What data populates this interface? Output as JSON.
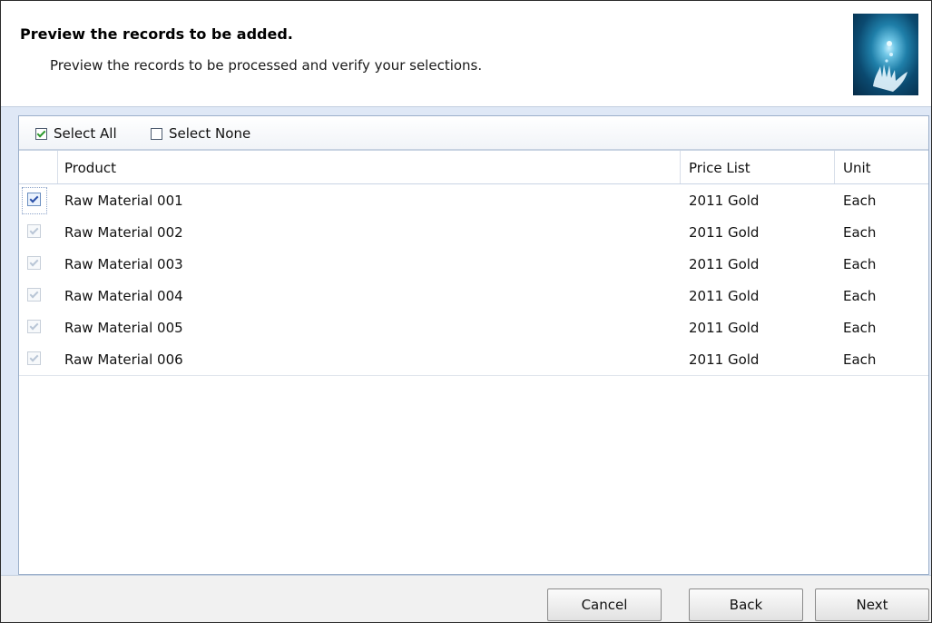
{
  "header": {
    "title": "Preview the records to be added.",
    "subtitle": "Preview the records to be processed and verify your selections.",
    "image_icon": "hand-light-icon"
  },
  "toolbar": {
    "select_all_label": "Select All",
    "select_all_checked": true,
    "select_none_label": "Select None",
    "select_none_checked": false
  },
  "grid": {
    "columns": [
      "Product",
      "Price List",
      "Unit"
    ],
    "rows": [
      {
        "checked": true,
        "product": "Raw Material 001",
        "price_list": "2011 Gold",
        "unit": "Each"
      },
      {
        "checked": true,
        "product": "Raw Material 002",
        "price_list": "2011 Gold",
        "unit": "Each"
      },
      {
        "checked": true,
        "product": "Raw Material 003",
        "price_list": "2011 Gold",
        "unit": "Each"
      },
      {
        "checked": true,
        "product": "Raw Material 004",
        "price_list": "2011 Gold",
        "unit": "Each"
      },
      {
        "checked": true,
        "product": "Raw Material 005",
        "price_list": "2011 Gold",
        "unit": "Each"
      },
      {
        "checked": true,
        "product": "Raw Material 006",
        "price_list": "2011 Gold",
        "unit": "Each"
      }
    ]
  },
  "footer": {
    "cancel_label": "Cancel",
    "back_label": "Back",
    "next_label": "Next"
  },
  "colors": {
    "panel_background": "#dfe8f6",
    "panel_border": "#9bafca",
    "check_green": "#2e9a2e",
    "check_blue": "#2b50a8"
  }
}
